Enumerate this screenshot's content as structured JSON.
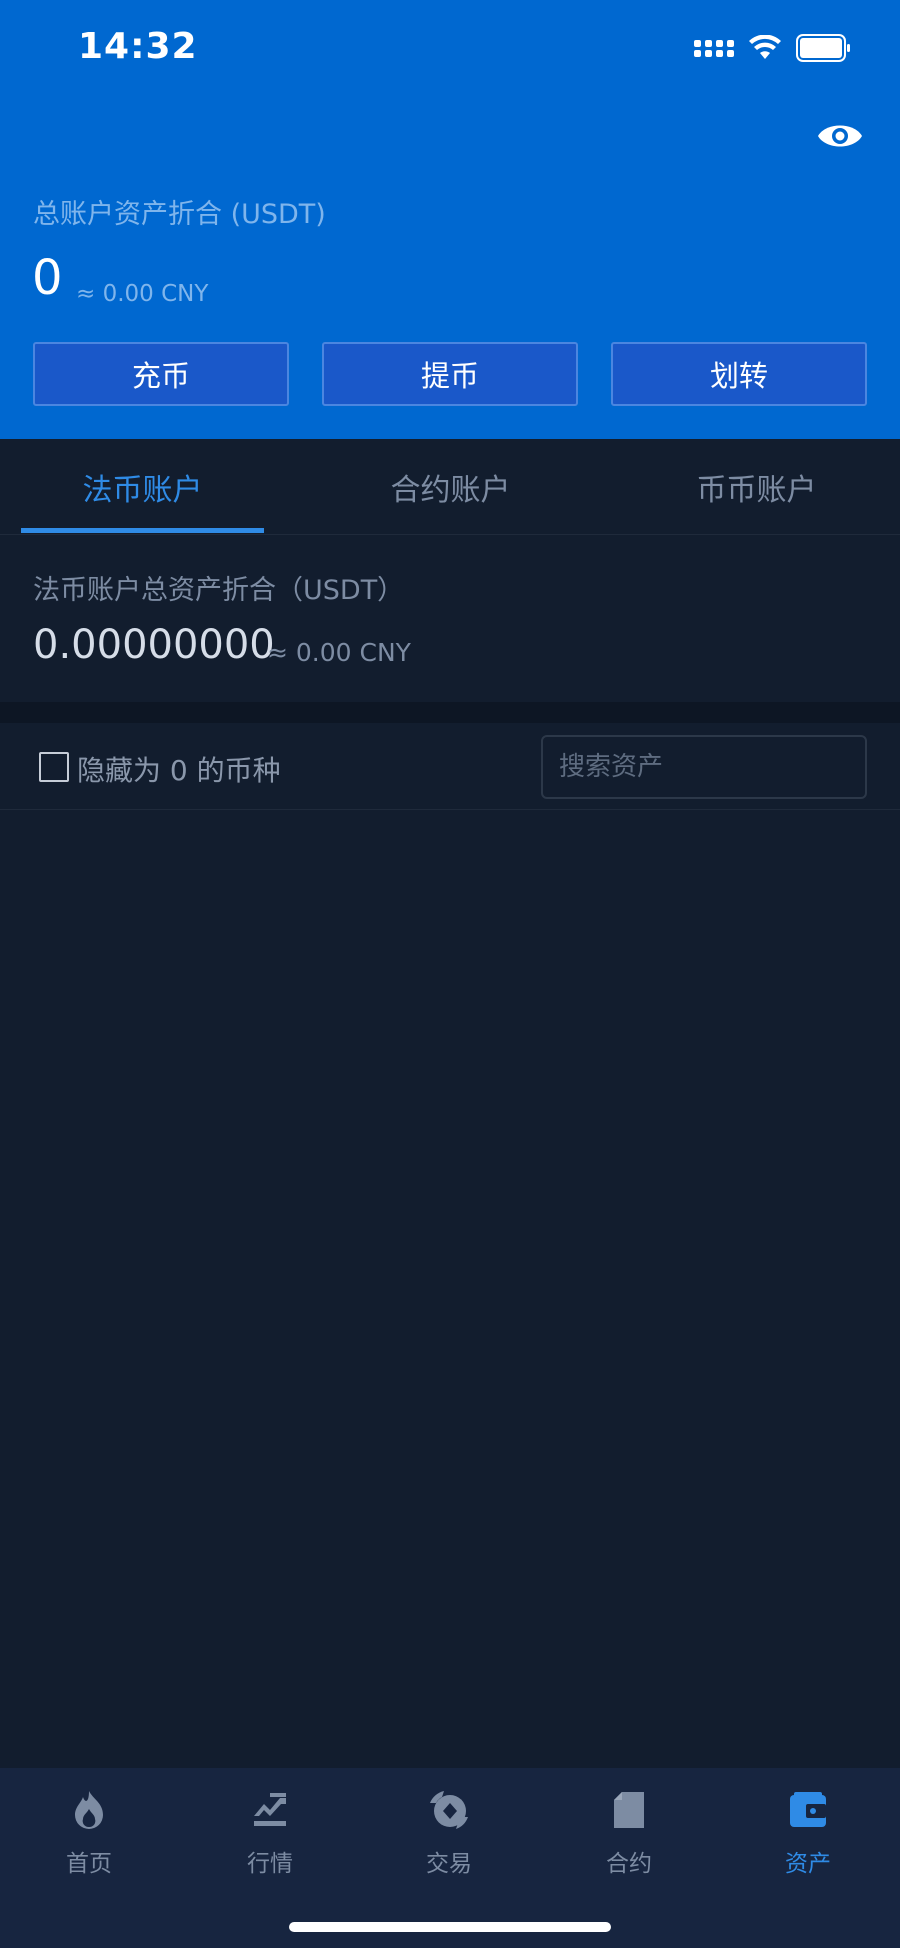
{
  "status_bar": {
    "time": "14:32"
  },
  "summary": {
    "label": "总账户资产折合 (USDT)",
    "value": "0",
    "cny": "≈ 0.00 CNY"
  },
  "actions": {
    "deposit": "充币",
    "withdraw": "提币",
    "transfer": "划转"
  },
  "tabs": [
    {
      "label": "法币账户",
      "active": true
    },
    {
      "label": "合约账户",
      "active": false
    },
    {
      "label": "币币账户",
      "active": false
    }
  ],
  "account": {
    "label": "法币账户总资产折合（USDT）",
    "value": "0.00000000",
    "cny": "≈ 0.00 CNY"
  },
  "filter": {
    "hide_zero_label": "隐藏为 0 的币种",
    "hide_zero_checked": false,
    "search_placeholder": "搜索资产"
  },
  "bottom_nav": [
    {
      "label": "首页",
      "icon": "flame-icon",
      "active": false
    },
    {
      "label": "行情",
      "icon": "market-icon",
      "active": false
    },
    {
      "label": "交易",
      "icon": "trade-icon",
      "active": false
    },
    {
      "label": "合约",
      "icon": "contract-icon",
      "active": false
    },
    {
      "label": "资产",
      "icon": "wallet-icon",
      "active": true
    }
  ],
  "colors": {
    "header_bg": "#0068d0",
    "page_bg": "#121d2e",
    "accent": "#2f8be6",
    "nav_bg": "#172540"
  }
}
